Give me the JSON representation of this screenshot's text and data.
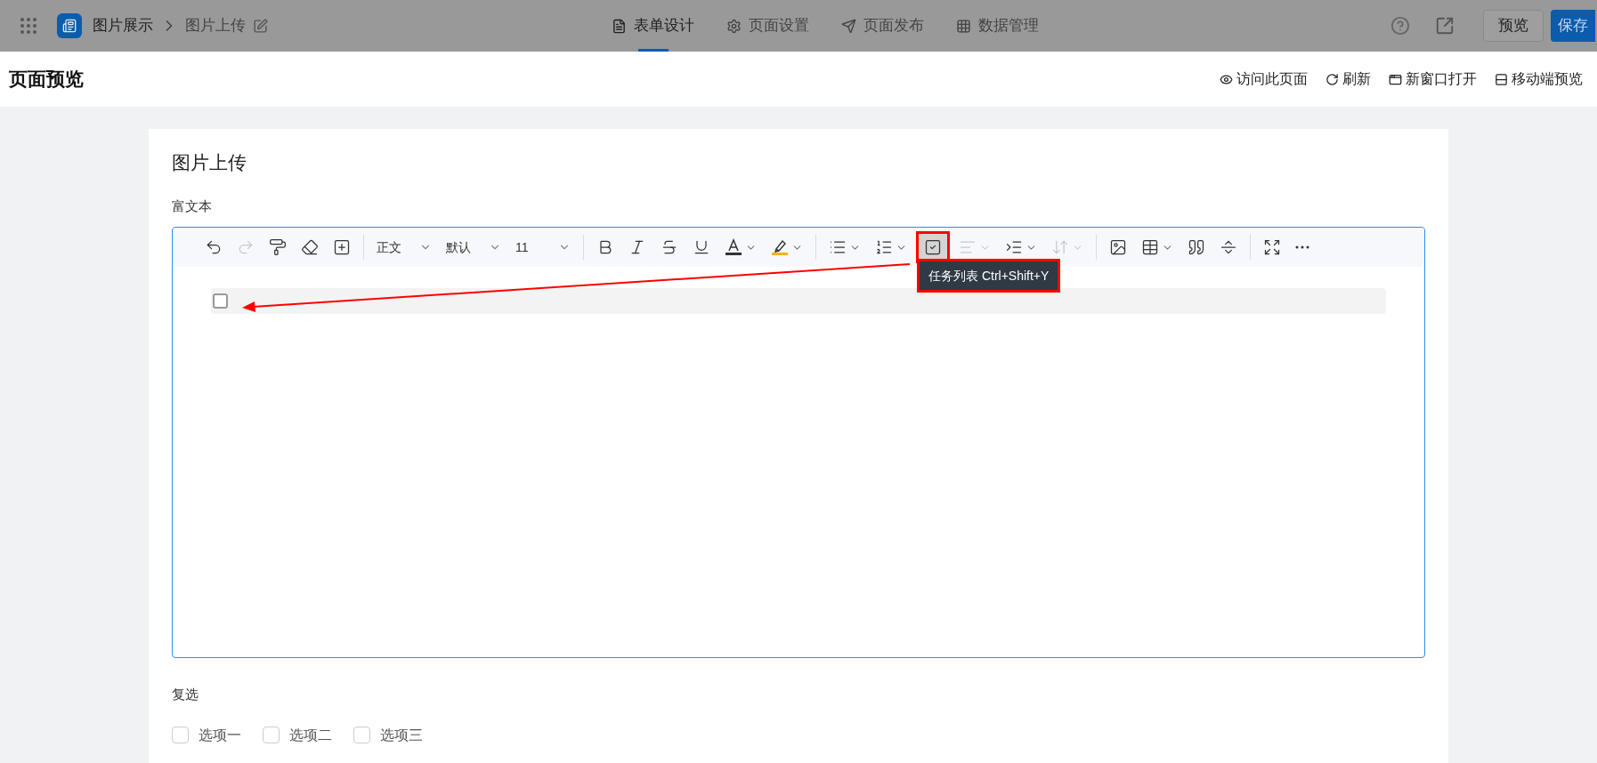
{
  "top_bar": {
    "app": "图片展示",
    "page": "图片上传",
    "tabs": [
      {
        "label": "表单设计",
        "selected": true
      },
      {
        "label": "页面设置",
        "selected": false
      },
      {
        "label": "页面发布",
        "selected": false
      },
      {
        "label": "数据管理",
        "selected": false
      }
    ],
    "buttons": [
      "预览",
      "保存"
    ]
  },
  "header": {
    "title": "页面预览",
    "actions": [
      "访问此页面",
      "刷新",
      "新窗口打开",
      "移动端预览"
    ]
  },
  "form": {
    "title": "图片上传",
    "rich_text": {
      "label": "富文本",
      "toolbar": {
        "groups": [
          {
            "buttons": [
              {
                "disabled": false,
                "dropdown": false,
                "selected": false
              },
              {
                "disabled": true,
                "dropdown": false,
                "selected": false
              },
              {
                "disabled": false,
                "dropdown": false,
                "selected": false
              },
              {
                "disabled": false,
                "dropdown": false,
                "selected": false
              },
              {
                "disabled": false,
                "dropdown": false,
                "selected": false
              }
            ]
          },
          {
            "selects": [
              "正文",
              "默认",
              "11"
            ]
          },
          {
            "buttons": [
              {
                "disabled": false,
                "dropdown": false,
                "selected": false
              },
              {
                "disabled": false,
                "dropdown": false,
                "selected": false
              },
              {
                "disabled": false,
                "dropdown": false,
                "selected": false
              },
              {
                "disabled": false,
                "dropdown": false,
                "selected": false
              },
              {
                "disabled": false,
                "dropdown": true,
                "selected": false
              },
              {
                "disabled": false,
                "dropdown": true,
                "selected": false
              }
            ]
          },
          {
            "buttons": [
              {
                "disabled": false,
                "dropdown": true,
                "selected": false
              },
              {
                "disabled": false,
                "dropdown": true,
                "selected": false
              },
              {
                "disabled": false,
                "dropdown": false,
                "selected": true,
                "annotated": true
              },
              {
                "disabled": true,
                "dropdown": true,
                "selected": false
              },
              {
                "disabled": false,
                "dropdown": true,
                "selected": false
              },
              {
                "disabled": true,
                "dropdown": true,
                "selected": false
              }
            ]
          },
          {
            "buttons": [
              {
                "disabled": false,
                "dropdown": false,
                "selected": false
              },
              {
                "disabled": false,
                "dropdown": true,
                "selected": false
              },
              {
                "disabled": false,
                "dropdown": false,
                "selected": false
              },
              {
                "disabled": false,
                "dropdown": false,
                "selected": false
              }
            ]
          },
          {
            "buttons": [
              {
                "disabled": false,
                "dropdown": false,
                "selected": false
              },
              {
                "disabled": false,
                "dropdown": false,
                "selected": false
              }
            ]
          }
        ]
      },
      "tooltip": {
        "text": "任务列表 Ctrl+Shift+Y",
        "annotated": true
      },
      "tasks": [
        {
          "checked": false
        }
      ]
    },
    "checkbox_group": {
      "label": "复选",
      "options": [
        {
          "label": "选项一",
          "checked": false
        },
        {
          "label": "选项二",
          "checked": false
        },
        {
          "label": "选项三",
          "checked": false
        }
      ]
    }
  }
}
